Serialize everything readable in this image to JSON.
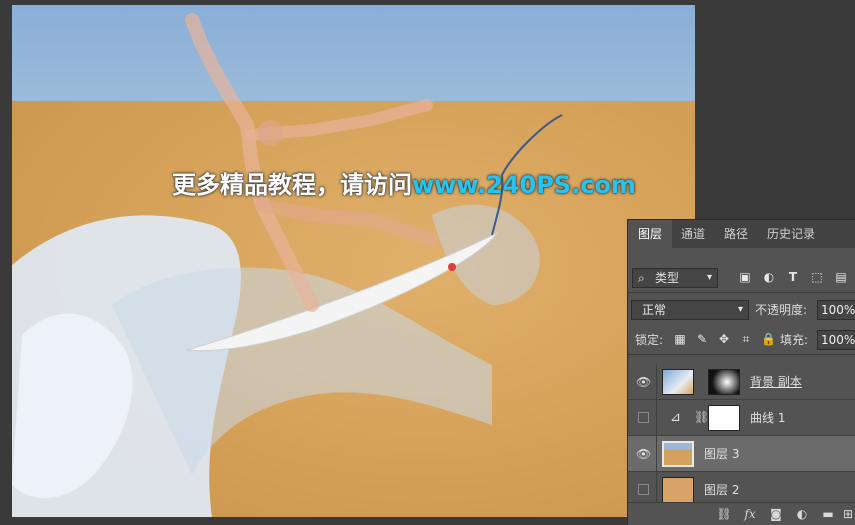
{
  "watermark": {
    "text": "更多精品教程，请访问",
    "url": "www.240PS.com"
  },
  "panel": {
    "tabs": [
      "图层",
      "通道",
      "路径",
      "历史记录"
    ],
    "filter": {
      "kind_label": "类型"
    },
    "blend_mode": "正常",
    "opacity_label": "不透明度:",
    "opacity_value": "100%",
    "lock_label": "锁定:",
    "fill_label": "填充:",
    "fill_value": "100%",
    "layers": [
      {
        "name": "背景 副本",
        "visible": true,
        "selected": false
      },
      {
        "name": "曲线 1",
        "visible": false,
        "selected": false
      },
      {
        "name": "图层 3",
        "visible": true,
        "selected": true
      },
      {
        "name": "图层 2",
        "visible": false,
        "selected": false
      }
    ],
    "bottom_icons": [
      "link-icon",
      "fx-icon",
      "mask-icon",
      "adjustment-icon",
      "folder-icon",
      "new-layer-icon",
      "trash-icon"
    ]
  },
  "colors": {
    "panel_bg": "#535353",
    "selected_row": "#6b6b6b",
    "url_color": "#28c3ee",
    "layer3_thumb": "#d4a25f",
    "layer2_thumb": "#d9a266"
  }
}
